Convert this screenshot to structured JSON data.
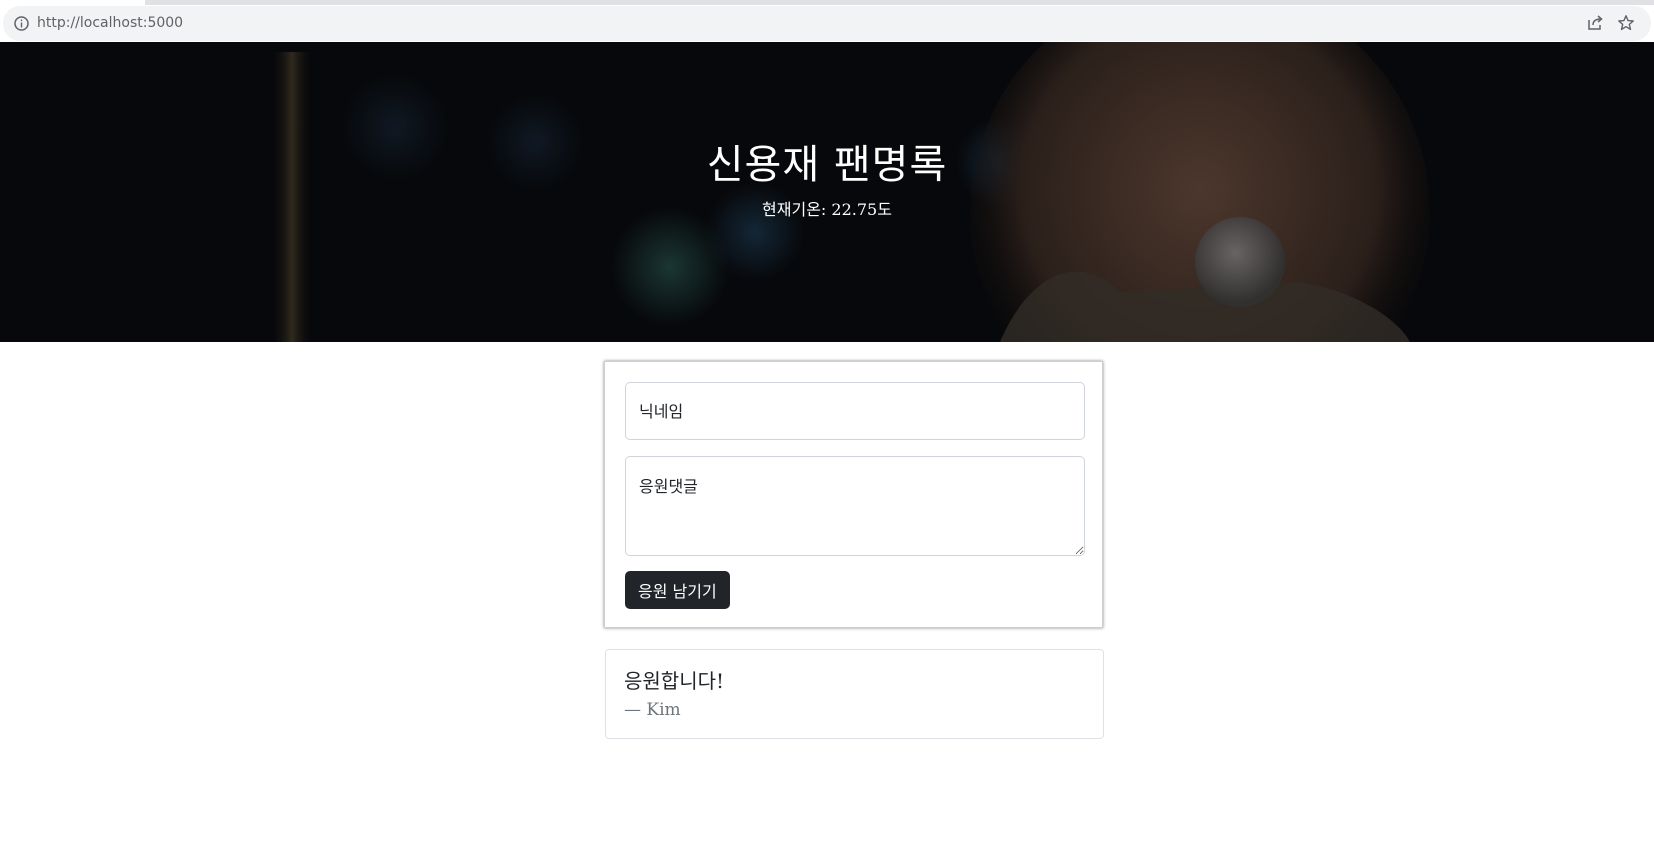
{
  "browser": {
    "url": "http://localhost:5000"
  },
  "hero": {
    "title": "신용재 팬명록",
    "temperature_text": "현재기온: 22.75도"
  },
  "form": {
    "nickname_placeholder": "닉네임",
    "comment_placeholder": "응원댓글",
    "submit_label": "응원 남기기"
  },
  "comments": [
    {
      "text": "응원합니다!",
      "author": "— Kim"
    }
  ],
  "colors": {
    "button_bg": "#212529",
    "author_text": "#6c757d"
  }
}
